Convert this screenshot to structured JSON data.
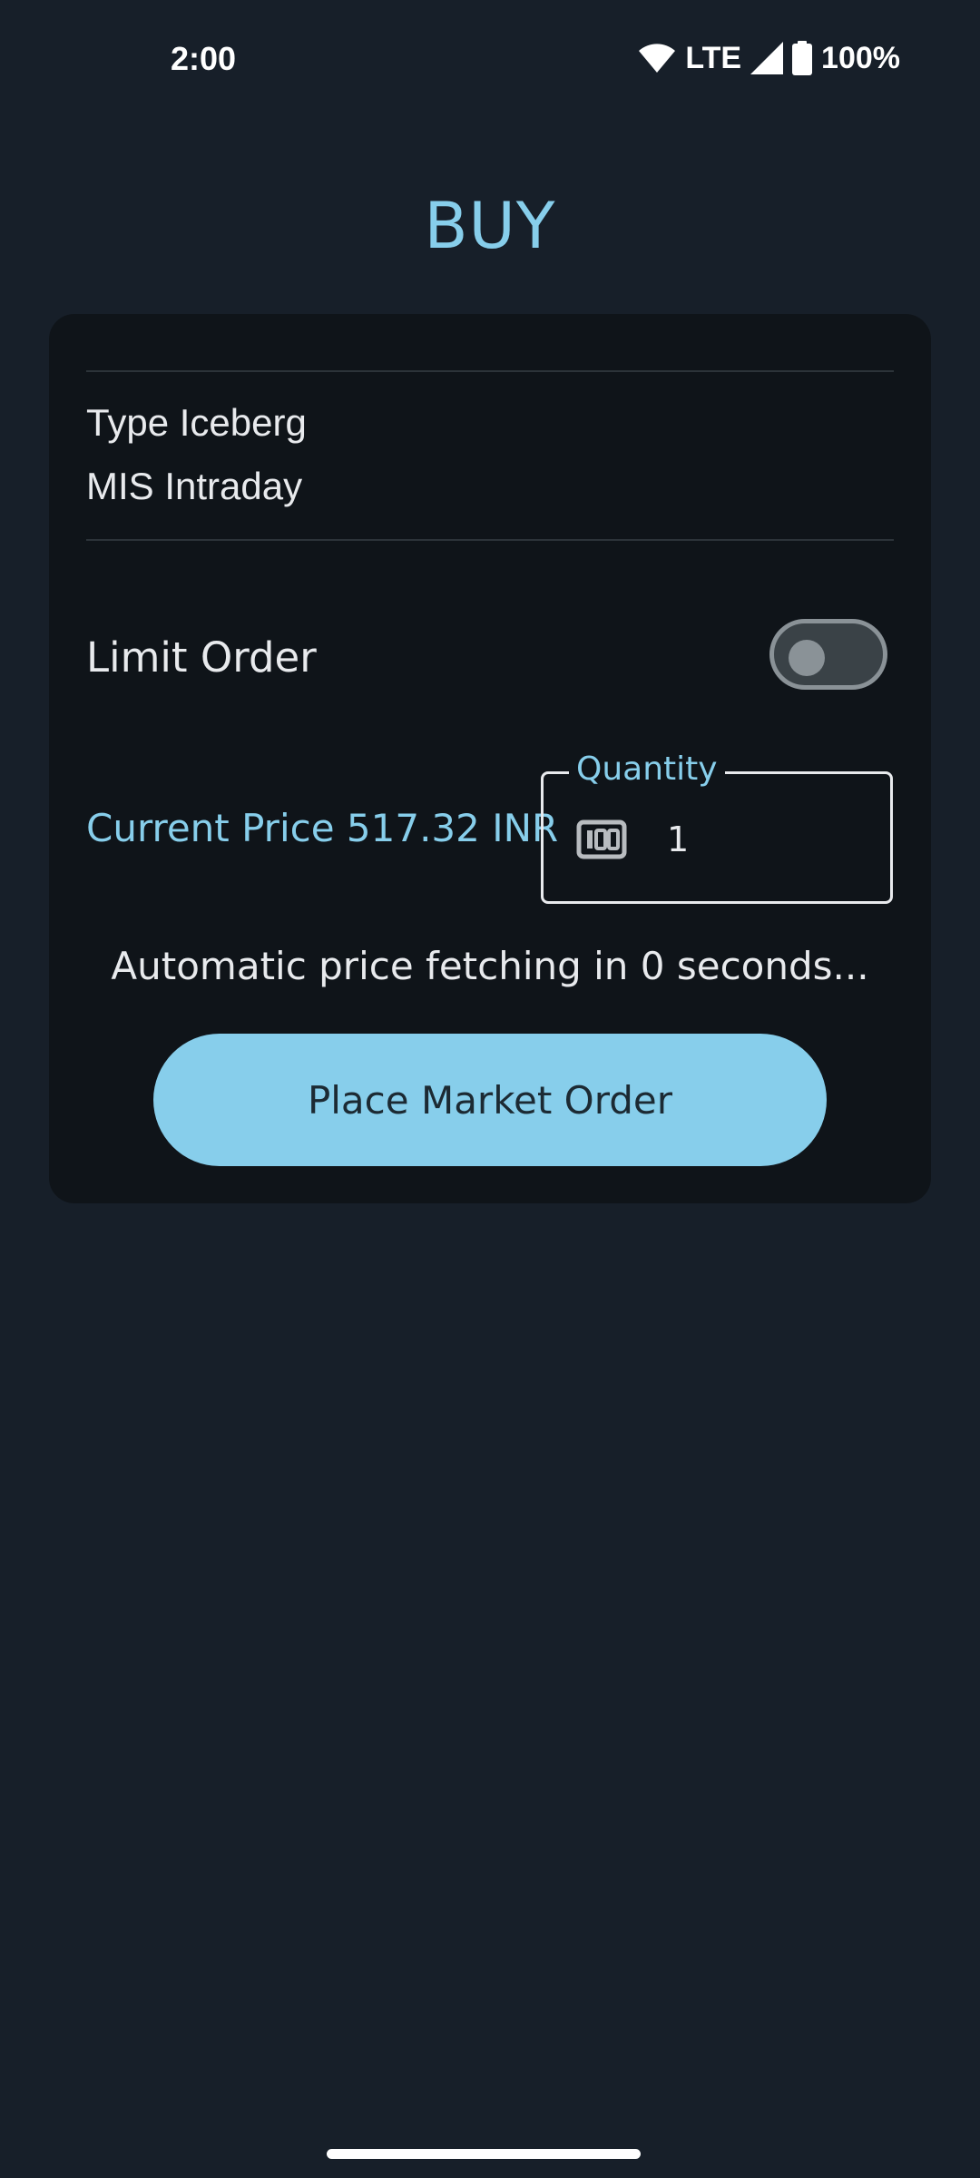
{
  "status_bar": {
    "time": "2:00",
    "network": "LTE",
    "battery": "100%",
    "icons": [
      "wifi-icon",
      "signal-icon",
      "battery-icon"
    ]
  },
  "page": {
    "title": "BUY"
  },
  "order": {
    "type_line": "Type Iceberg",
    "product_line": "MIS Intraday",
    "limit_order_label": "Limit Order",
    "limit_order_enabled": false,
    "current_price_text": "Current Price 517.32 INR",
    "quantity": {
      "label": "Quantity",
      "value": "1",
      "icon": "counter-icon"
    },
    "auto_fetch_text": "Automatic price fetching in 0 seconds...",
    "place_button_label": "Place Market Order"
  },
  "colors": {
    "accent": "#87ceeb",
    "background": "#171f29",
    "card": "#0f1419",
    "text": "#e8eaed"
  }
}
